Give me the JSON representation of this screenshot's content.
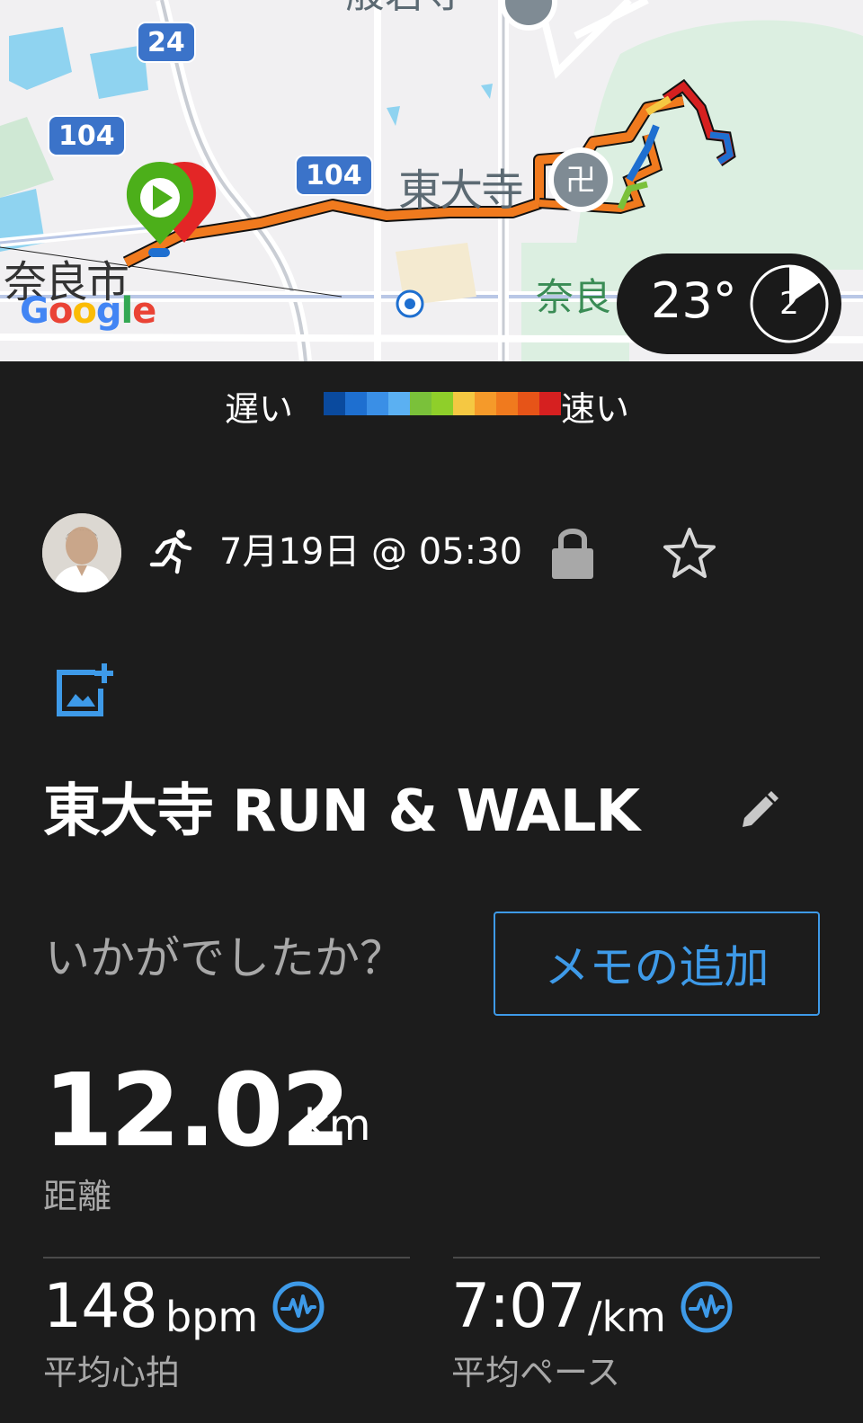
{
  "map": {
    "labels": {
      "temple": "東大寺",
      "hannya": "般若寺",
      "nara_city": "奈良市",
      "nara_park": "奈良"
    },
    "route_shields": [
      "24",
      "104",
      "104"
    ],
    "google_logo": [
      "G",
      "o",
      "o",
      "g",
      "l",
      "e"
    ],
    "weather": {
      "temperature": "23°",
      "dial_value": "2"
    }
  },
  "speed_legend": {
    "slow_label": "遅い",
    "fast_label": "速い",
    "colors": [
      "#0a4a9e",
      "#1e6fd0",
      "#3a8fe6",
      "#5bb0f2",
      "#7ac13a",
      "#8fcf2a",
      "#f5c842",
      "#f59a2a",
      "#f07a1e",
      "#e65418",
      "#d62020"
    ]
  },
  "activity": {
    "date_time": "7月19日 @ 05:30",
    "title": "東大寺 RUN & WALK",
    "prompt": "いかがでしたか？",
    "memo_button": "メモの追加"
  },
  "stats": {
    "distance": {
      "value": "12.02",
      "unit": "km",
      "label": "距離"
    },
    "avg_heart_rate": {
      "value": "148",
      "unit": "bpm",
      "label": "平均心拍"
    },
    "avg_pace": {
      "value": "7:07",
      "unit": "/km",
      "label": "平均ペース"
    }
  },
  "icons": {
    "run": "running-person-icon",
    "lock": "lock-icon",
    "star": "star-icon",
    "add_photo": "add-photo-icon",
    "edit": "pencil-icon",
    "heart_rate": "heart-rate-icon",
    "pace": "pace-icon"
  },
  "colors": {
    "accent_blue": "#3e9ae8",
    "background": "#1c1c1c",
    "secondary_text": "#a8a8a8"
  }
}
